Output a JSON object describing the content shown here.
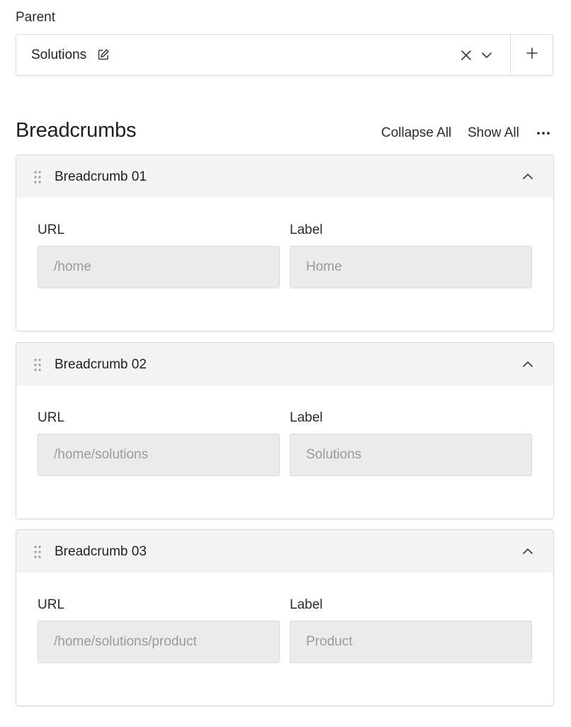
{
  "parent": {
    "label": "Parent",
    "value": "Solutions",
    "icons": [
      "edit-icon",
      "clear-icon",
      "chevron-down-icon",
      "plus-icon"
    ]
  },
  "breadcrumbs": {
    "title": "Breadcrumbs",
    "collapse_all_label": "Collapse All",
    "show_all_label": "Show All",
    "more_icon": "more-horizontal-icon",
    "items": [
      {
        "title": "Breadcrumb 01",
        "url_label": "URL",
        "url_value": "/home",
        "label_label": "Label",
        "label_value": "Home"
      },
      {
        "title": "Breadcrumb 02",
        "url_label": "URL",
        "url_value": "/home/solutions",
        "label_label": "Label",
        "label_value": "Solutions"
      },
      {
        "title": "Breadcrumb 03",
        "url_label": "URL",
        "url_value": "/home/solutions/product",
        "label_label": "Label",
        "label_value": "Product"
      }
    ]
  },
  "colors": {
    "border": "#d6d6d6",
    "header_bg": "#f4f4f4",
    "input_bg": "#ebebeb",
    "input_text": "#9a9a9a",
    "text": "#1f1f1f"
  }
}
